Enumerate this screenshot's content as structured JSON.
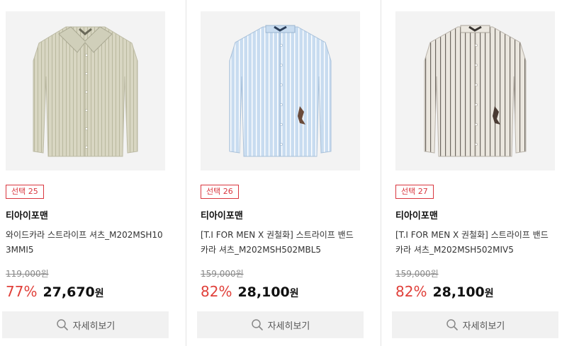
{
  "colors": {
    "accent_red": "#d9363e",
    "discount_red": "#e0403a",
    "button_bg": "#f1f1f1"
  },
  "products": [
    {
      "badge": "선택 25",
      "brand": "티아이포맨",
      "title": "와이드카라 스트라이프 셔츠_M202MSH103MMI5",
      "original_price": "119,000원",
      "discount_rate": "77%",
      "price": "27,670",
      "currency": "원",
      "detail_label": "자세히보기",
      "shirt_color": "#d8d6c2",
      "stripe_color": "#b9b89e",
      "collar": "wide"
    },
    {
      "badge": "선택 26",
      "brand": "티아이포맨",
      "title": "[T.I FOR MEN X 권철화] 스트라이프 밴드카라 셔츠_M202MSH502MBL5",
      "original_price": "159,000원",
      "discount_rate": "82%",
      "price": "28,100",
      "currency": "원",
      "detail_label": "자세히보기",
      "shirt_color": "#c8dcf0",
      "stripe_color": "#ffffff",
      "collar": "band"
    },
    {
      "badge": "선택 27",
      "brand": "티아이포맨",
      "title": "[T.I FOR MEN X 권철화] 스트라이프 밴드카라 셔츠_M202MSH502MIV5",
      "original_price": "159,000원",
      "discount_rate": "82%",
      "price": "28,100",
      "currency": "원",
      "detail_label": "자세히보기",
      "shirt_color": "#ebe7df",
      "stripe_color": "#6d6760",
      "collar": "band"
    }
  ]
}
